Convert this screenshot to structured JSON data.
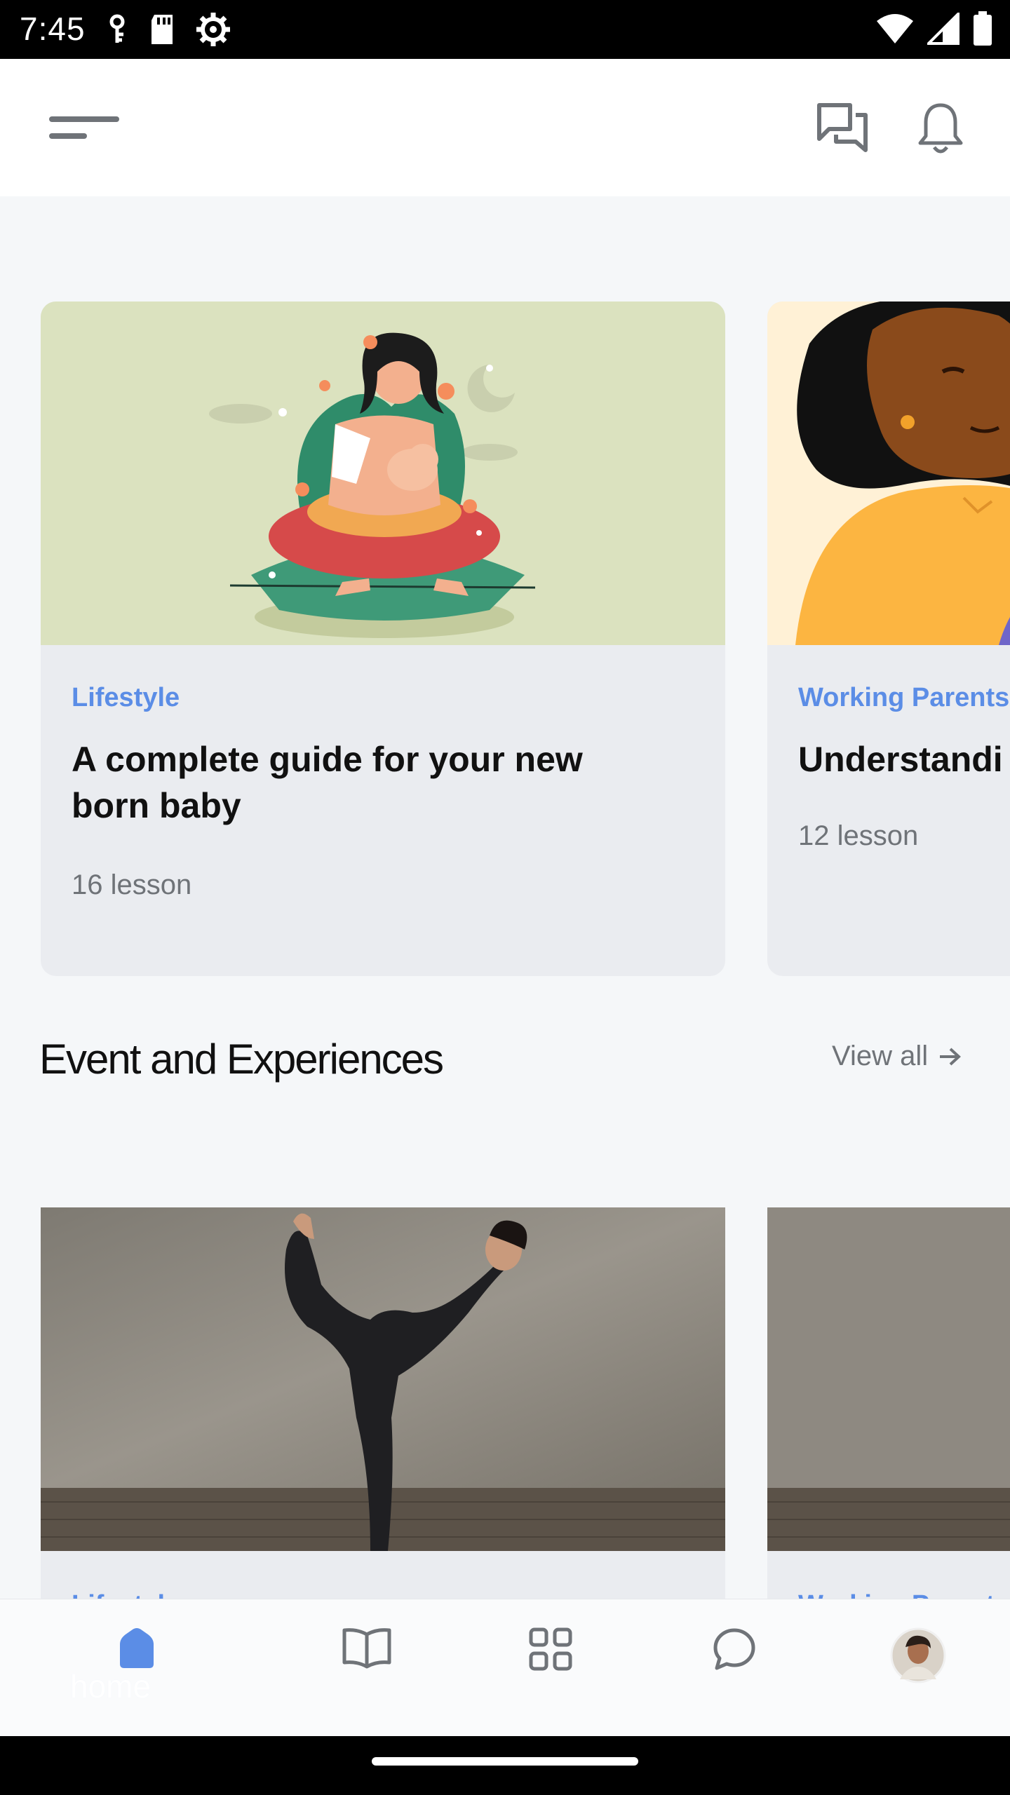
{
  "status_bar": {
    "time": "7:45",
    "left_icons": [
      "key-icon",
      "sd-card-icon",
      "settings-gear-icon"
    ],
    "right_icons": [
      "wifi-icon",
      "signal-icon",
      "battery-icon"
    ]
  },
  "app_bar": {
    "icons": [
      "menu-icon",
      "chat-bubbles-icon",
      "bell-icon"
    ]
  },
  "courses": [
    {
      "category": "Lifestyle",
      "title": "A complete guide for your new born baby",
      "lessons": "16 lesson",
      "image": "mother-breastfeeding-illustration"
    },
    {
      "category": "Working Parents",
      "title": "Understandi",
      "lessons": "12 lesson",
      "image": "woman-illustration"
    }
  ],
  "events_section": {
    "title": "Event and Experiences",
    "view_all": "View all",
    "cards": [
      {
        "category": "Lifestyle",
        "image": "yoga-pose-photo"
      },
      {
        "category": "Working Parents",
        "image": "wall-photo"
      }
    ]
  },
  "bottom_nav": {
    "items": [
      {
        "icon": "home-icon",
        "label": "home",
        "active": true
      },
      {
        "icon": "book-icon",
        "label": "",
        "active": false
      },
      {
        "icon": "grid-icon",
        "label": "",
        "active": false
      },
      {
        "icon": "chat-icon",
        "label": "",
        "active": false
      },
      {
        "icon": "avatar",
        "label": "",
        "active": false
      }
    ]
  },
  "colors": {
    "accent": "#5b8de6",
    "card_bg": "#eaecf0",
    "page_bg": "#f5f7f9"
  }
}
